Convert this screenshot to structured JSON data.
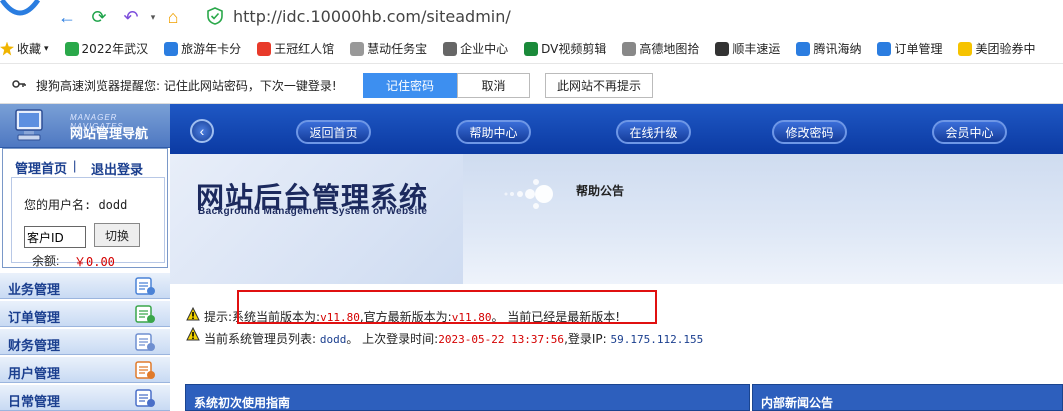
{
  "browser": {
    "url": "http://idc.10000hb.com/siteadmin/"
  },
  "bookmarks": [
    {
      "label": "收藏",
      "color": "#f0b400"
    },
    {
      "label": "2022年武汉",
      "color": "#2aa84a"
    },
    {
      "label": "旅游年卡分",
      "color": "#2b7de0"
    },
    {
      "label": "王冠红人馆",
      "color": "#e83a2a"
    },
    {
      "label": "慧动任务宝",
      "color": "#999999"
    },
    {
      "label": "企业中心",
      "color": "#666666"
    },
    {
      "label": "DV视频剪辑",
      "color": "#1a8a3a"
    },
    {
      "label": "高德地图拾",
      "color": "#888888"
    },
    {
      "label": "顺丰速运",
      "color": "#333333"
    },
    {
      "label": "腾讯海纳",
      "color": "#2b7de0"
    },
    {
      "label": "订单管理",
      "color": "#2b7de0"
    },
    {
      "label": "美团验券中",
      "color": "#f6c300"
    }
  ],
  "password_prompt": {
    "message": "搜狗高速浏览器提醒您:  记住此网站密码，下次一键登录!",
    "save": "记住密码",
    "cancel": "取消",
    "never": "此网站不再提示"
  },
  "sidebar": {
    "sub": "MANAGER NAVIGATES",
    "title": "网站管理导航",
    "home": "管理首页",
    "sep": "|",
    "logout": "退出登录",
    "user_label": "您的用户名: dodd",
    "customer_id_value": "客户ID",
    "switch": "切换",
    "balance_label": "余额:",
    "balance_value": "￥0.00",
    "menu": [
      {
        "label": "业务管理"
      },
      {
        "label": "订单管理"
      },
      {
        "label": "财务管理"
      },
      {
        "label": "用户管理"
      },
      {
        "label": "日常管理"
      }
    ]
  },
  "topnav": {
    "back": "‹",
    "items": [
      {
        "label": "返回首页"
      },
      {
        "label": "帮助中心"
      },
      {
        "label": "在线升级"
      },
      {
        "label": "修改密码"
      },
      {
        "label": "会员中心"
      }
    ]
  },
  "banner": {
    "title": "网站后台管理系统",
    "subtitle": "Background Management System of Website",
    "help_title": "帮助公告"
  },
  "tip": {
    "prefix": "提示:",
    "text1": "系统当前版本为:",
    "version1": "v11.80",
    "text2": ",官方最新版本为:",
    "version2": "v11.80",
    "text3": "。 当前已经是最新版本!"
  },
  "admin_line": {
    "text1": "当前系统管理员列表: ",
    "admin": "dodd",
    "text2": "。 上次登录时间:",
    "time": "2023-05-22 13:37:56",
    "text3": ",登录IP: ",
    "ip": "59.175.112.155"
  },
  "panels": {
    "left_title": "系统初次使用指南",
    "right_title": "内部新闻公告"
  }
}
